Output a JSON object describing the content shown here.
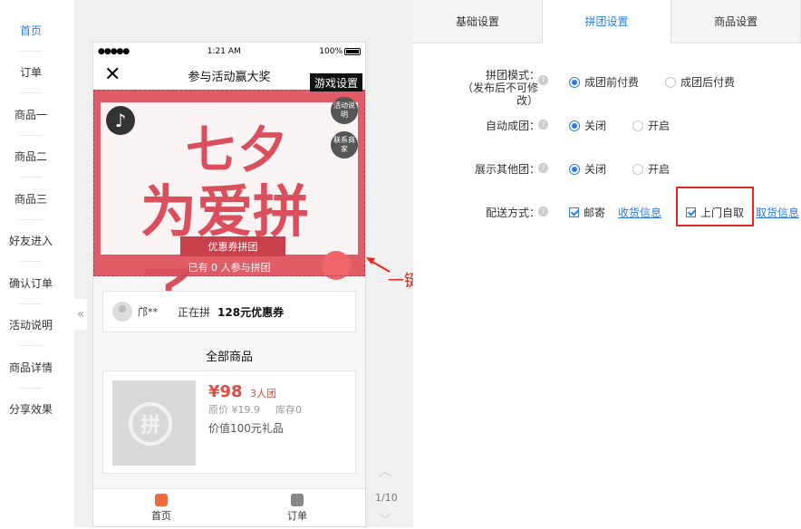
{
  "left_nav": {
    "items": [
      {
        "label": "首页",
        "active": true
      },
      {
        "label": "订单"
      },
      {
        "label": "商品一"
      },
      {
        "label": "商品二"
      },
      {
        "label": "商品三"
      },
      {
        "label": "好友进入"
      },
      {
        "label": "确认订单"
      },
      {
        "label": "活动说明"
      },
      {
        "label": "商品详情"
      },
      {
        "label": "分享效果"
      }
    ],
    "collapse_glyph": "«"
  },
  "phone": {
    "status": {
      "signal": "●●●●●",
      "time": "1:21 AM",
      "battery": "100%"
    },
    "nav": {
      "close_glyph": "✕",
      "title": "参与活动赢大奖"
    },
    "game_settings": "游戏设置",
    "banner": {
      "line1": "七夕",
      "line2": "为爱拼了",
      "ribbon": "优惠券拼团",
      "participants": "已有 0 人参与拼团",
      "music_glyph": "♪",
      "rules_btn": "活动说明",
      "contact_btn": "联系商家"
    },
    "groupon": {
      "user": "邝**",
      "status": "正在拼",
      "item": "128元优惠券"
    },
    "all_products": "全部商品",
    "product": {
      "img_glyph": "拼",
      "price": "¥98",
      "team_size": "3人团",
      "orig_price": "原价 ¥19.9",
      "stock": "库存0",
      "gift": "价值100元礼品"
    },
    "tabbar": {
      "home": "首页",
      "order": "订单"
    }
  },
  "pager": {
    "count": "1/10",
    "up": "︿",
    "down": "﹀"
  },
  "annotation": {
    "text": "一键更换拼团主题"
  },
  "settings": {
    "tabs": [
      {
        "label": "基础设置"
      },
      {
        "label": "拼团设置",
        "active": true
      },
      {
        "label": "商品设置"
      }
    ],
    "mode": {
      "label": "拼团模式：",
      "sublabel": "（发布后不可修改）",
      "opt1": "成团前付费",
      "opt2": "成团后付费"
    },
    "auto": {
      "label": "自动成团：",
      "opt1": "关闭",
      "opt2": "开启"
    },
    "show_other": {
      "label": "展示其他团：",
      "opt1": "关闭",
      "opt2": "开启"
    },
    "delivery": {
      "label": "配送方式：",
      "mail": "邮寄",
      "mail_link": "收货信息",
      "pickup": "上门自取",
      "pickup_link": "取货信息"
    },
    "help_glyph": "?"
  },
  "colors": {
    "accent": "#2c7be5",
    "highlight": "#e8281e",
    "banner": "#e05c66"
  }
}
